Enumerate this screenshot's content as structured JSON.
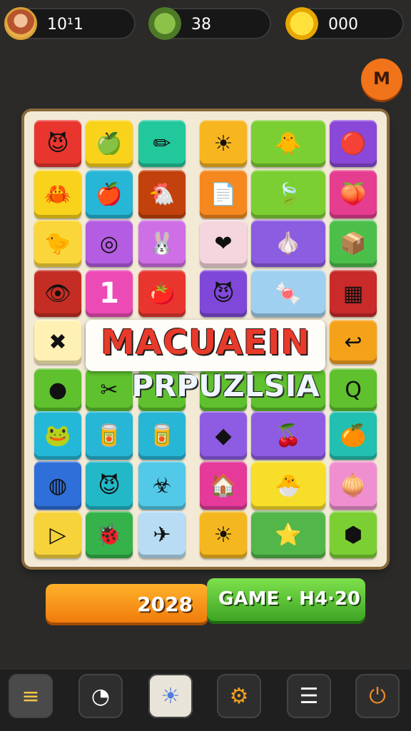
{
  "top": {
    "avatar_value": "10¹1",
    "leaf_value": "38",
    "coin_value": "000"
  },
  "menu_button_glyph": "M",
  "title": {
    "line1": "MACUAEIN",
    "line2": "PRPUZLSIA"
  },
  "tiles": [
    {
      "c": "#e8362f",
      "g": "😈"
    },
    {
      "c": "#f9d31b",
      "g": "🍏"
    },
    {
      "c": "#22c89c",
      "g": "✏"
    },
    {
      "c": "#f7b51f",
      "g": "☀"
    },
    {
      "c": "#7ccf33",
      "g": "🐥",
      "w": 2
    },
    {
      "c": "#8a48d8",
      "g": "🔴"
    },
    {
      "c": "#f9d31b",
      "g": "🦀"
    },
    {
      "c": "#27b6d6",
      "g": "🍎"
    },
    {
      "c": "#c2410c",
      "g": "🐔"
    },
    {
      "c": "#f5881e",
      "g": "📄"
    },
    {
      "c": "#7ccf33",
      "g": "🍃",
      "w": 2
    },
    {
      "c": "#e53d8f",
      "g": "🍑"
    },
    {
      "c": "#fbd63a",
      "g": "🐤"
    },
    {
      "c": "#b45ce2",
      "g": "◎"
    },
    {
      "c": "#cf6fe6",
      "g": "🐰"
    },
    {
      "c": "#f6d6de",
      "g": "❤"
    },
    {
      "c": "#8b5de0",
      "g": "🧄",
      "w": 2
    },
    {
      "c": "#4cbf4a",
      "g": "📦"
    },
    {
      "c": "#c42d24",
      "g": "👁"
    },
    {
      "c": "#ec4bb6",
      "g": "1"
    },
    {
      "c": "#e8362f",
      "g": "🍅"
    },
    {
      "c": "#8048d8",
      "g": "😈"
    },
    {
      "c": "#9fd0f0",
      "g": "🍬",
      "w": 2
    },
    {
      "c": "#c92a2a",
      "g": "▦"
    },
    {
      "c": "#fff1b3",
      "g": "✖"
    },
    {
      "c": "#ffffff",
      "g": ""
    },
    {
      "c": "#ffffff",
      "g": ""
    },
    {
      "c": "#ffffff",
      "g": ""
    },
    {
      "c": "#ffffff",
      "g": "",
      "w": 2
    },
    {
      "c": "#f5a21b",
      "g": "↩"
    },
    {
      "c": "#5ec12d",
      "g": "●"
    },
    {
      "c": "#5ec12d",
      "g": "✂"
    },
    {
      "c": "#5ec12d",
      "g": ""
    },
    {
      "c": "#5ec12d",
      "g": ""
    },
    {
      "c": "#5ec12d",
      "g": "",
      "w": 2
    },
    {
      "c": "#5ec12d",
      "g": "Q"
    },
    {
      "c": "#24b8d8",
      "g": "🐸"
    },
    {
      "c": "#27b6d6",
      "g": "🥫"
    },
    {
      "c": "#27b6d6",
      "g": "🥫"
    },
    {
      "c": "#8e5ce2",
      "g": "◆"
    },
    {
      "c": "#8e5ce2",
      "g": "🍒",
      "w": 2
    },
    {
      "c": "#22c0b0",
      "g": "🍊"
    },
    {
      "c": "#2f6fd9",
      "g": "◍"
    },
    {
      "c": "#22b8c8",
      "g": "😈"
    },
    {
      "c": "#52c9e8",
      "g": "☣"
    },
    {
      "c": "#e53a9a",
      "g": "🏠"
    },
    {
      "c": "#f7de2a",
      "g": "🐣",
      "w": 2
    },
    {
      "c": "#f08fd0",
      "g": "🧅"
    },
    {
      "c": "#f7d33b",
      "g": "▷"
    },
    {
      "c": "#35b34a",
      "g": "🐞"
    },
    {
      "c": "#b7dcf4",
      "g": "✈"
    },
    {
      "c": "#f5b71f",
      "g": "☀"
    },
    {
      "c": "#53b64a",
      "g": "⭐",
      "w": 2
    },
    {
      "c": "#7ccf33",
      "g": "⬢"
    }
  ],
  "bars": {
    "orange_value": "2028",
    "green_value": "GAME · H4·20"
  },
  "nav": [
    {
      "id": "layers",
      "g": "≡",
      "c": "#f5c54a"
    },
    {
      "id": "timer",
      "g": "◔",
      "c": "#ffffff"
    },
    {
      "id": "sun",
      "g": "☀",
      "c": "#4f7be0"
    },
    {
      "id": "gear",
      "g": "⚙",
      "c": "#f3a11e"
    },
    {
      "id": "list",
      "g": "☰",
      "c": "#ffffff"
    },
    {
      "id": "power",
      "g": "⏻",
      "c": "#f08a25"
    }
  ]
}
